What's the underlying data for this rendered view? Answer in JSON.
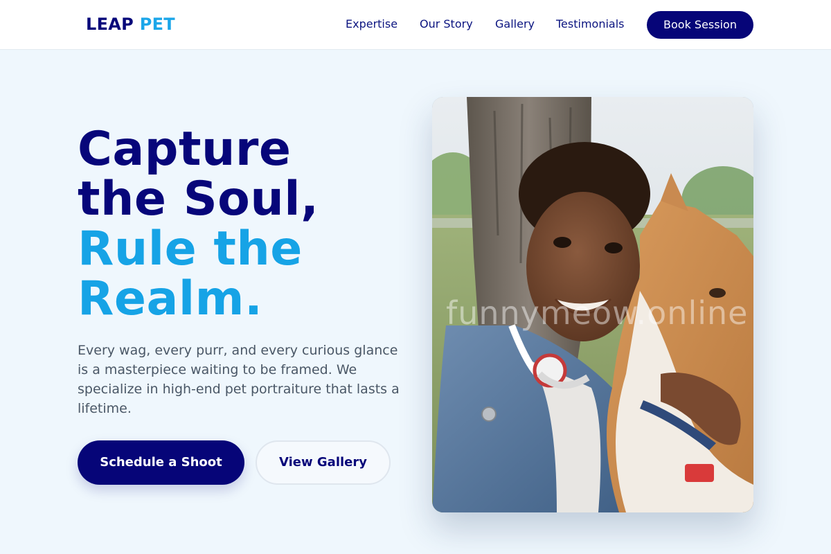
{
  "brand": {
    "part1": "LEAP",
    "part2": "PET"
  },
  "nav": {
    "links": [
      "Expertise",
      "Our Story",
      "Gallery",
      "Testimonials"
    ],
    "cta": "Book Session"
  },
  "hero": {
    "title_lines": [
      "Capture",
      "the Soul,"
    ],
    "title_accent_lines": [
      "Rule the",
      "Realm."
    ],
    "description": "Every wag, every purr, and every curious glance is a masterpiece waiting to be framed. We specialize in high-end pet portraiture that lasts a lifetime.",
    "primary_button": "Schedule a Shoot",
    "secondary_button": "View Gallery"
  },
  "photo": {
    "watermark": "funnymeow.online"
  },
  "colors": {
    "navy": "#060578",
    "sky": "#16a3e6",
    "background": "#eff7fd"
  }
}
